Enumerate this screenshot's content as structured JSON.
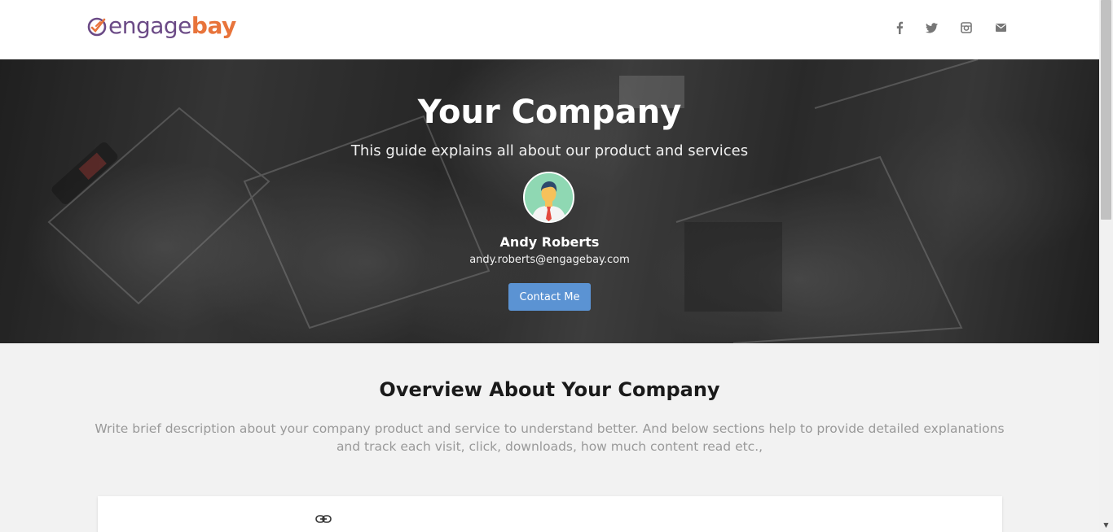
{
  "header": {
    "logo": {
      "part1": "engage",
      "part2": "bay"
    },
    "social": [
      {
        "name": "facebook-icon",
        "glyph": "f"
      },
      {
        "name": "twitter-icon",
        "glyph": "twitter"
      },
      {
        "name": "instagram-icon",
        "glyph": "instagram"
      },
      {
        "name": "mail-icon",
        "glyph": "mail"
      }
    ]
  },
  "hero": {
    "title": "Your Company",
    "subtitle": "This guide explains all about our product and services",
    "person_name": "Andy Roberts",
    "person_email": "andy.roberts@engagebay.com",
    "contact_label": "Contact Me"
  },
  "overview": {
    "title": "Overview About Your Company",
    "description": "Write brief description about your company product and service to understand better. And below sections help to provide detailed explanations and track each visit, click, downloads, how much content read etc.,"
  },
  "colors": {
    "brand_purple": "#6b4a86",
    "brand_orange": "#e8743b",
    "button_blue": "#5b93d3",
    "page_bg": "#f2f2f2"
  }
}
